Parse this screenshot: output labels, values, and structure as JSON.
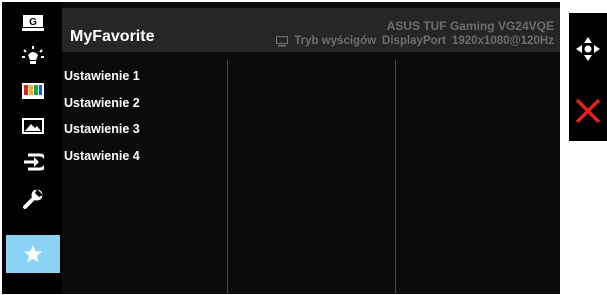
{
  "header": {
    "title": "MyFavorite",
    "model": "ASUS TUF Gaming VG24VQE",
    "mode": "Tryb wyścigów",
    "input": "DisplayPort",
    "resolution": "1920x1080@120Hz"
  },
  "sidebar": {
    "items": [
      {
        "icon": "gaming-icon",
        "label": "G",
        "selected": false
      },
      {
        "icon": "brightness-icon",
        "selected": false
      },
      {
        "icon": "color-icon",
        "selected": false
      },
      {
        "icon": "image-icon",
        "selected": false
      },
      {
        "icon": "input-select-icon",
        "selected": false
      },
      {
        "icon": "system-setup-icon",
        "selected": false
      },
      {
        "icon": "star-icon",
        "selected": true
      }
    ]
  },
  "main": {
    "settings": [
      "Ustawienie 1",
      "Ustawienie 2",
      "Ustawienie 3",
      "Ustawienie 4"
    ]
  },
  "controls": {
    "items": [
      {
        "icon": "navigation-joystick-icon"
      },
      {
        "icon": "close-icon"
      }
    ]
  },
  "colors": {
    "accent": "#8ad3f5",
    "close": "#e2231a",
    "panel": "#000000",
    "header_bg": "#262626",
    "muted_text": "#6e6e6e"
  }
}
